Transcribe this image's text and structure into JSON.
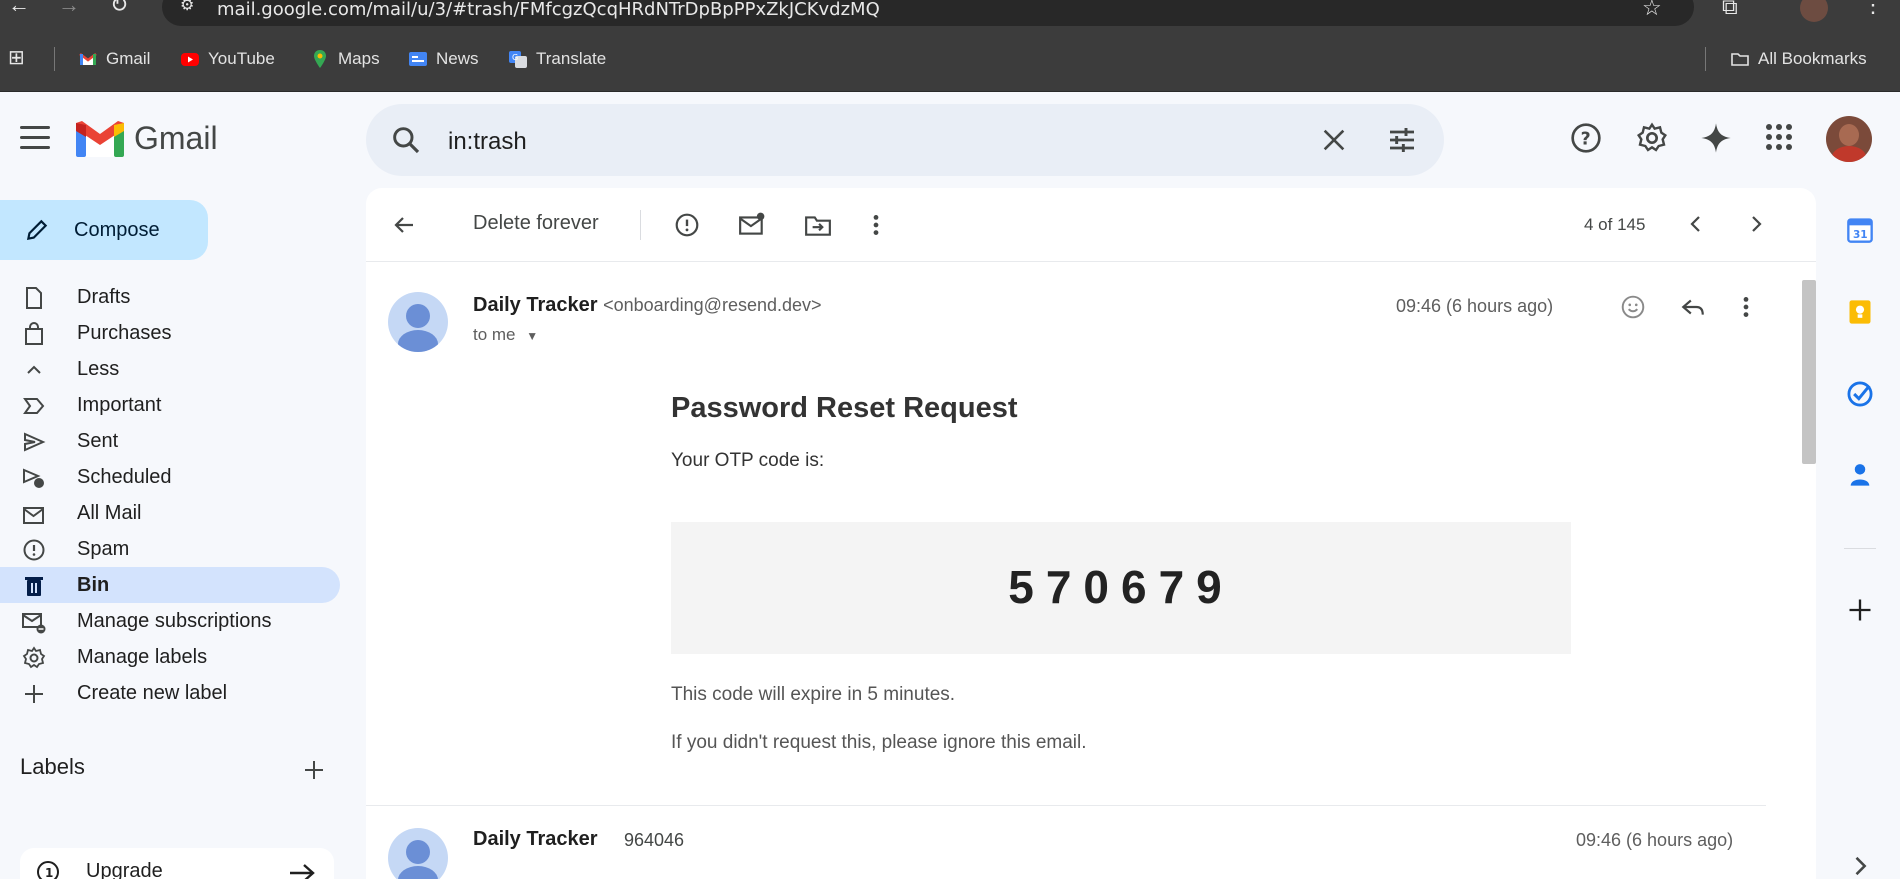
{
  "browser": {
    "url": "mail.google.com/mail/u/3/#trash/FMfcgzQcqHRdNTrDpBpPPxZkJCKvdzMQ",
    "bookmarks": [
      "Gmail",
      "YouTube",
      "Maps",
      "News",
      "Translate"
    ],
    "all_bookmarks": "All Bookmarks"
  },
  "header": {
    "app_name": "Gmail",
    "search_value": "in:trash"
  },
  "sidebar": {
    "compose_label": "Compose",
    "items": [
      {
        "label": "Drafts",
        "icon": "drafts-icon"
      },
      {
        "label": "Purchases",
        "icon": "purchases-icon"
      },
      {
        "label": "Less",
        "icon": "chevron-up-icon"
      },
      {
        "label": "Important",
        "icon": "important-icon"
      },
      {
        "label": "Sent",
        "icon": "sent-icon"
      },
      {
        "label": "Scheduled",
        "icon": "scheduled-icon"
      },
      {
        "label": "All Mail",
        "icon": "all-mail-icon"
      },
      {
        "label": "Spam",
        "icon": "spam-icon"
      },
      {
        "label": "Bin",
        "icon": "bin-icon",
        "active": true
      },
      {
        "label": "Manage subscriptions",
        "icon": "manage-subscriptions-icon"
      },
      {
        "label": "Manage labels",
        "icon": "gear-icon"
      },
      {
        "label": "Create new label",
        "icon": "plus-icon"
      }
    ],
    "labels_heading": "Labels",
    "upgrade_label": "Upgrade"
  },
  "toolbar": {
    "delete_forever": "Delete forever",
    "pager": "4 of 145"
  },
  "message": {
    "sender_name": "Daily Tracker",
    "sender_email": "<onboarding@resend.dev>",
    "recipient": "to me",
    "time": "09:46 (6 hours ago)",
    "body": {
      "title": "Password Reset Request",
      "intro": "Your OTP code is:",
      "otp": "570679",
      "expiry": "This code will expire in 5 minutes.",
      "ignore": "If you didn't request this, please ignore this email."
    }
  },
  "message2": {
    "sender_name": "Daily Tracker",
    "snippet": "964046",
    "time": "09:46 (6 hours ago)"
  },
  "colors": {
    "accent": "#c2e7ff",
    "active_nav": "#d3e3fd",
    "search_bg": "#e9eef6",
    "background": "#f6f8fc"
  }
}
